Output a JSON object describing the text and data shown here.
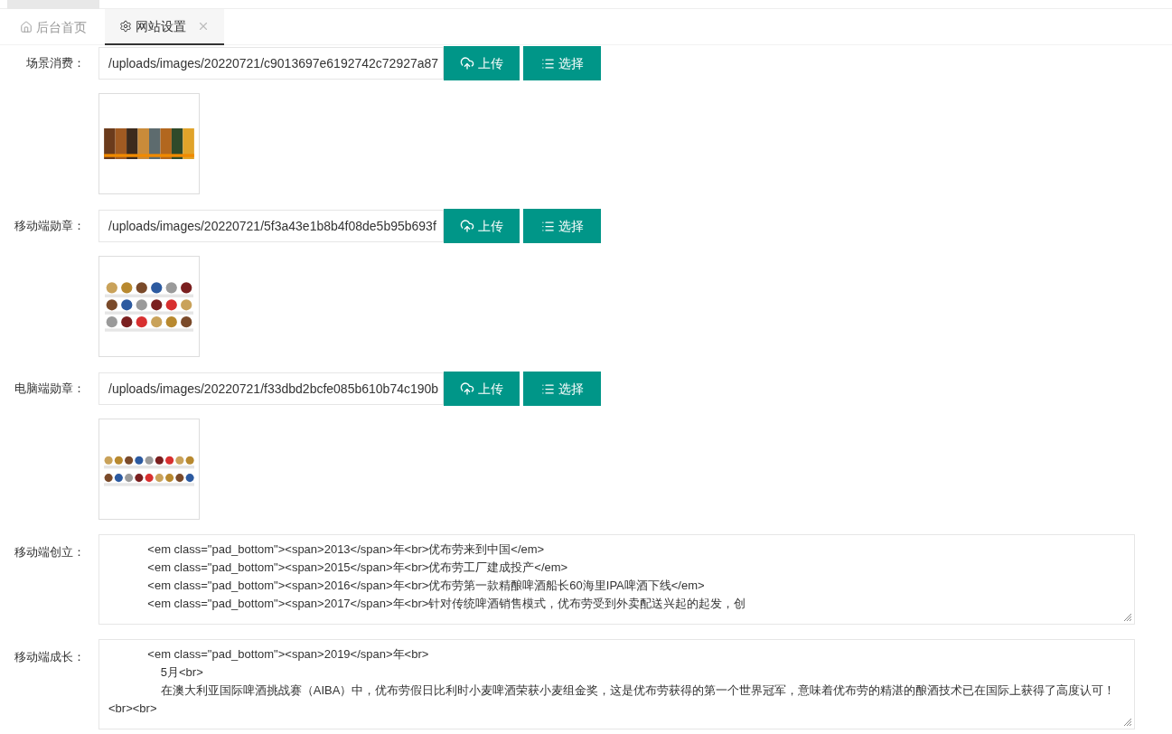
{
  "tabs": [
    {
      "label": "后台首页",
      "selected": false
    },
    {
      "label": "网站设置",
      "selected": true
    }
  ],
  "fields": [
    {
      "label": "场景消费：",
      "value": "/uploads/images/20220721/c9013697e6192742c72927a87",
      "upload": "上传",
      "choose": "选择"
    },
    {
      "label": "移动端勋章：",
      "value": "/uploads/images/20220721/5f3a43e1b8b4f08de5b95b693f",
      "upload": "上传",
      "choose": "选择"
    },
    {
      "label": "电脑端勋章：",
      "value": "/uploads/images/20220721/f33dbd2bcfe085b610b74c190b",
      "upload": "上传",
      "choose": "选择"
    },
    {
      "kind": "text",
      "label": "移动端创立：",
      "value": "            <em class=\"pad_bottom\"><span>2013</span>年<br>优布劳来到中国</em>\n            <em class=\"pad_bottom\"><span>2015</span>年<br>优布劳工厂建成投产</em>\n            <em class=\"pad_bottom\"><span>2016</span>年<br>优布劳第一款精酿啤酒船长60海里IPA啤酒下线</em>\n            <em class=\"pad_bottom\"><span>2017</span>年<br>针对传统啤酒销售模式，优布劳受到外卖配送兴起的起发，创"
    },
    {
      "kind": "text",
      "label": "移动端成长：",
      "value": "            <em class=\"pad_bottom\"><span>2019</span>年<br>\n                5月<br>\n                在澳大利亚国际啤酒挑战赛（AIBA）中，优布劳假日比利时小麦啤酒荣获小麦组金奖，这是优布劳获得的第一个世界冠军，意味着优布劳的精湛的酿酒技术已在国际上获得了高度认可！<br><br>"
    }
  ]
}
